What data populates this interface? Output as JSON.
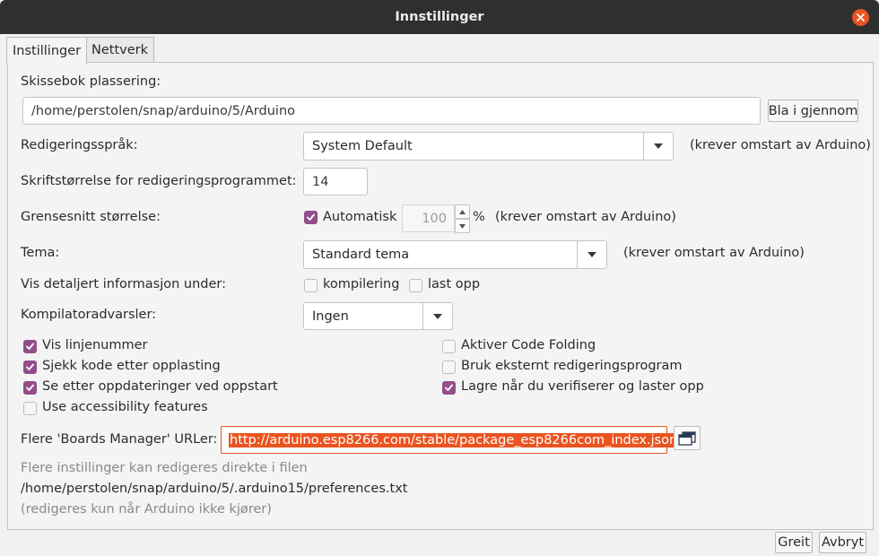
{
  "window": {
    "title": "Innstillinger"
  },
  "tabs": [
    {
      "label": "Instillinger",
      "active": true
    },
    {
      "label": "Nettverk",
      "active": false
    }
  ],
  "sketchbook": {
    "label": "Skissebok plassering:",
    "path": "/home/perstolen/snap/arduino/5/Arduino",
    "browse_label": "Bla i gjennom"
  },
  "editor_language": {
    "label": "Redigeringsspråk:",
    "value": "System Default",
    "note": "(krever omstart av Arduino)"
  },
  "font_size": {
    "label": "Skriftstørrelse for redigeringsprogrammet:",
    "value": "14"
  },
  "interface_scale": {
    "label": "Grensesnitt størrelse:",
    "auto_label": "Automatisk",
    "auto_checked": true,
    "value": "100",
    "unit": "%",
    "note": "(krever omstart av Arduino)"
  },
  "theme": {
    "label": "Tema:",
    "value": "Standard tema",
    "note": "(krever omstart av Arduino)"
  },
  "verbose": {
    "label": "Vis detaljert informasjon under:",
    "compile_label": "kompilering",
    "compile_checked": false,
    "upload_label": "last opp",
    "upload_checked": false
  },
  "compiler_warnings": {
    "label": "Kompilatoradvarsler:",
    "value": "Ingen"
  },
  "options_left": [
    {
      "label": "Vis linjenummer",
      "checked": true
    },
    {
      "label": "Sjekk kode etter opplasting",
      "checked": true
    },
    {
      "label": "Se etter oppdateringer ved oppstart",
      "checked": true
    },
    {
      "label": "Use accessibility features",
      "checked": false
    }
  ],
  "options_right": [
    {
      "label": "Aktiver Code Folding",
      "checked": false
    },
    {
      "label": "Bruk eksternt redigeringsprogram",
      "checked": false
    },
    {
      "label": "Lagre når du verifiserer og laster opp",
      "checked": true
    }
  ],
  "boards_manager": {
    "label": "Flere 'Boards Manager' URLer:",
    "url": "http://arduino.esp8266.com/stable/package_esp8266com_index.json"
  },
  "footer_info": {
    "line1": "Flere instillinger kan redigeres direkte i filen",
    "line2": "/home/perstolen/snap/arduino/5/.arduino15/preferences.txt",
    "line3": "(redigeres kun når Arduino ikke kjører)"
  },
  "buttons": {
    "ok_label": "Greit",
    "cancel_label": "Avbryt"
  },
  "colors": {
    "accent": "#e95420",
    "checkbox": "#924d8b",
    "titlebar": "#2f2f2f"
  }
}
